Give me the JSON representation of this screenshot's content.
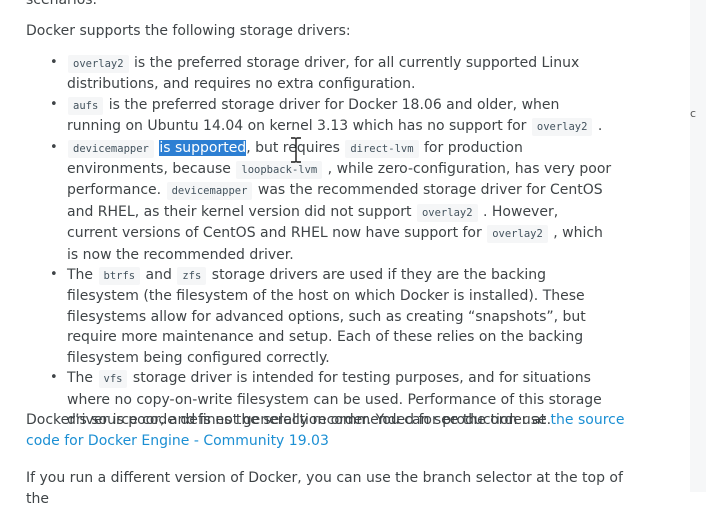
{
  "top_fragment": "scenarios.",
  "intro": "Docker supports the following storage drivers:",
  "items": [
    {
      "c1": "overlay2",
      "t1": " is the preferred storage driver, for all currently supported Linux distributions, and requires no extra configuration."
    },
    {
      "c1": "aufs",
      "t1": " is the preferred storage driver for Docker 18.06 and older, when running on Ubuntu 14.04 on kernel 3.13 which has no support for ",
      "c2": "overlay2",
      "t2": " ."
    },
    {
      "c1": "devicemapper",
      "sel": "is supported",
      "t1": ", but requires ",
      "c2": "direct-lvm",
      "t2": " for production environments, because ",
      "c3": "loopback-lvm",
      "t3": " , while zero-configuration, has very poor performance. ",
      "c4": "devicemapper",
      "t4": " was the recommended storage driver for CentOS and RHEL, as their kernel version did not support ",
      "c5": "overlay2",
      "t5": " . However, current versions of CentOS and RHEL now have support for ",
      "c6": "overlay2",
      "t6": " , which is now the recommended driver."
    },
    {
      "t0": "The ",
      "c1": "btrfs",
      "t1": " and ",
      "c2": "zfs",
      "t2": " storage drivers are used if they are the backing filesystem (the filesystem of the host on which Docker is installed). These filesystems allow for advanced options, such as creating “snapshots”, but require more maintenance and setup. Each of these relies on the backing filesystem being configured correctly."
    },
    {
      "t0": "The ",
      "c1": "vfs",
      "t1": " storage driver is intended for testing purposes, and for situations where no copy-on-write filesystem can be used. Performance of this storage driver is poor, and is not generally recommended for production use."
    }
  ],
  "para2_text": "Docker’s source code defines the selection order. You can see the order at ",
  "para2_link": "the source code for Docker Engine - Community 19.03",
  "para3": "If you run a different version of Docker, you can use the branch selector at the top of the",
  "sidebar_fragment": "c",
  "colors": {
    "link": "#1b8fd3",
    "selection": "#2d7fd3",
    "text": "#3f4447"
  },
  "icons": {
    "cursor": "text-cursor-icon"
  }
}
